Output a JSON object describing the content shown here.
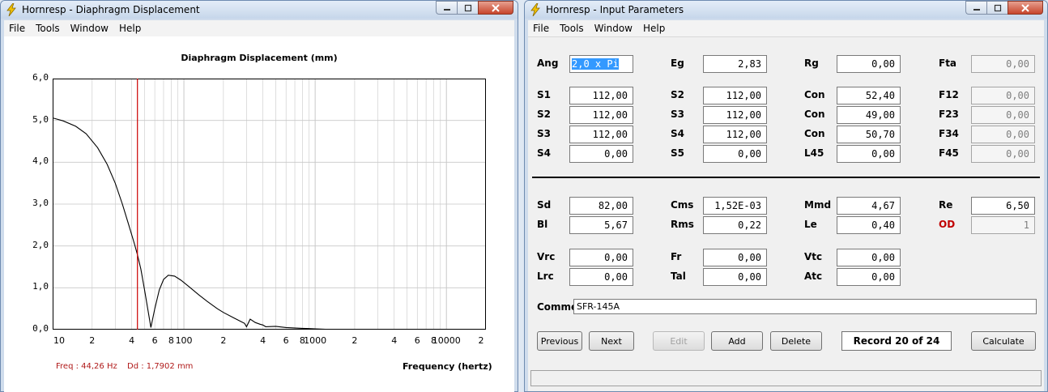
{
  "left_window": {
    "title": "Hornresp - Diaphragm Displacement",
    "menu": [
      "File",
      "Tools",
      "Window",
      "Help"
    ],
    "cursor_freq": "Freq : 44,26 Hz",
    "cursor_dd": "Dd : 1,7902 mm"
  },
  "right_window": {
    "title": "Hornresp - Input Parameters",
    "menu": [
      "File",
      "Tools",
      "Window",
      "Help"
    ],
    "params": [
      {
        "label": "Ang",
        "value": "2,0 x Pi"
      },
      {
        "label": "Eg",
        "value": "2,83"
      },
      {
        "label": "Rg",
        "value": "0,00"
      },
      {
        "label": "Fta",
        "value": "0,00"
      },
      {
        "label": "S1",
        "value": "112,00"
      },
      {
        "label": "S2",
        "value": "112,00"
      },
      {
        "label": "Con",
        "value": "52,40"
      },
      {
        "label": "F12",
        "value": "0,00"
      },
      {
        "label": "S2",
        "value": "112,00"
      },
      {
        "label": "S3",
        "value": "112,00"
      },
      {
        "label": "Con",
        "value": "49,00"
      },
      {
        "label": "F23",
        "value": "0,00"
      },
      {
        "label": "S3",
        "value": "112,00"
      },
      {
        "label": "S4",
        "value": "112,00"
      },
      {
        "label": "Con",
        "value": "50,70"
      },
      {
        "label": "F34",
        "value": "0,00"
      },
      {
        "label": "S4",
        "value": "0,00"
      },
      {
        "label": "S5",
        "value": "0,00"
      },
      {
        "label": "L45",
        "value": "0,00"
      },
      {
        "label": "F45",
        "value": "0,00"
      },
      {
        "label": "Sd",
        "value": "82,00"
      },
      {
        "label": "Cms",
        "value": "1,52E-03"
      },
      {
        "label": "Mmd",
        "value": "4,67"
      },
      {
        "label": "Re",
        "value": "6,50"
      },
      {
        "label": "Bl",
        "value": "5,67"
      },
      {
        "label": "Rms",
        "value": "0,22"
      },
      {
        "label": "Le",
        "value": "0,40"
      },
      {
        "label": "OD",
        "value": "1"
      },
      {
        "label": "Vrc",
        "value": "0,00"
      },
      {
        "label": "Fr",
        "value": "0,00"
      },
      {
        "label": "Vtc",
        "value": "0,00"
      },
      {
        "label": "Lrc",
        "value": "0,00"
      },
      {
        "label": "Tal",
        "value": "0,00"
      },
      {
        "label": "Atc",
        "value": "0,00"
      }
    ],
    "comment_label": "Comment",
    "comment_value": "SFR-145A",
    "buttons": {
      "previous": "Previous",
      "next": "Next",
      "edit": "Edit",
      "add": "Add",
      "delete": "Delete",
      "calculate": "Calculate"
    },
    "record": "Record 20 of 24"
  },
  "colors": {
    "curve": "#000000",
    "cursor": "#cc0000",
    "grid": "#c8c8c8"
  },
  "chart_data": {
    "type": "line",
    "title": "Diaphragm Displacement (mm)",
    "xlabel": "Frequency (hertz)",
    "ylabel": "",
    "x_scale": "log",
    "xlim": [
      10,
      20000
    ],
    "ylim": [
      0,
      6
    ],
    "yticks": [
      "0,0",
      "1,0",
      "2,0",
      "3,0",
      "4,0",
      "5,0",
      "6,0"
    ],
    "xticks": [
      {
        "v": 10,
        "label": "10"
      },
      {
        "v": 20,
        "label": "2"
      },
      {
        "v": 40,
        "label": "4"
      },
      {
        "v": 60,
        "label": "6"
      },
      {
        "v": 80,
        "label": "8"
      },
      {
        "v": 100,
        "label": "100"
      },
      {
        "v": 200,
        "label": "2"
      },
      {
        "v": 400,
        "label": "4"
      },
      {
        "v": 600,
        "label": "6"
      },
      {
        "v": 800,
        "label": "8"
      },
      {
        "v": 1000,
        "label": "1000"
      },
      {
        "v": 2000,
        "label": "2"
      },
      {
        "v": 4000,
        "label": "4"
      },
      {
        "v": 6000,
        "label": "6"
      },
      {
        "v": 8000,
        "label": "8"
      },
      {
        "v": 10000,
        "label": "10000"
      },
      {
        "v": 20000,
        "label": "2"
      }
    ],
    "grid": true,
    "cursor_x": 44.26,
    "series": [
      {
        "x": [
          10,
          12,
          15,
          18,
          22,
          26,
          30,
          34,
          38,
          42,
          44.26,
          47,
          50,
          53,
          56,
          60,
          65,
          70,
          76,
          85,
          95,
          110,
          130,
          150,
          180,
          200,
          240,
          270,
          290,
          300,
          320,
          350,
          380,
          400,
          420,
          500,
          600,
          800,
          1000,
          1200,
          20000
        ],
        "y": [
          5.06,
          4.99,
          4.86,
          4.68,
          4.35,
          3.95,
          3.5,
          3.0,
          2.5,
          2.05,
          1.79,
          1.45,
          0.97,
          0.5,
          0.05,
          0.5,
          0.95,
          1.2,
          1.3,
          1.28,
          1.18,
          1.02,
          0.83,
          0.68,
          0.5,
          0.41,
          0.28,
          0.2,
          0.15,
          0.07,
          0.25,
          0.17,
          0.13,
          0.11,
          0.07,
          0.08,
          0.05,
          0.03,
          0.02,
          0.01,
          0.0
        ]
      }
    ]
  }
}
